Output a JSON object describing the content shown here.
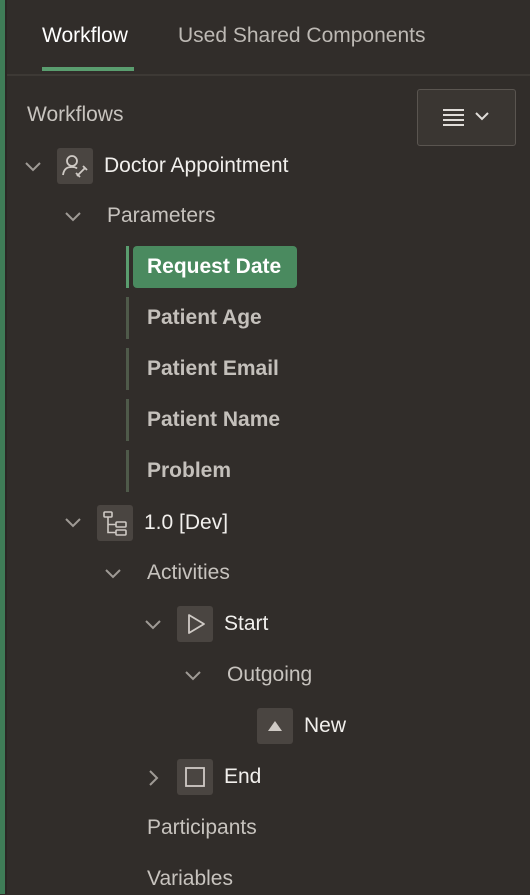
{
  "tabs": {
    "workflow": "Workflow",
    "used_shared_components": "Used Shared Components"
  },
  "tree": {
    "section_label": "Workflows",
    "root": {
      "label": "Doctor Appointment",
      "icon": "workflow-user-icon"
    },
    "parameters": {
      "label": "Parameters",
      "items": [
        "Request Date",
        "Patient Age",
        "Patient Email",
        "Patient Name",
        "Problem"
      ],
      "selected": "Request Date"
    },
    "version": {
      "label": "1.0 [Dev]",
      "icon": "version-tree-icon"
    },
    "activities": {
      "label": "Activities",
      "start": {
        "label": "Start",
        "icon": "play-icon"
      },
      "outgoing": {
        "label": "Outgoing"
      },
      "new": {
        "label": "New",
        "icon": "triangle-up-icon"
      },
      "end": {
        "label": "End",
        "icon": "square-icon"
      }
    },
    "participants": "Participants",
    "variables": "Variables"
  },
  "colors": {
    "background": "#312d2a",
    "accent": "#4a8a5f",
    "tab_underline": "#5a9d6f"
  }
}
